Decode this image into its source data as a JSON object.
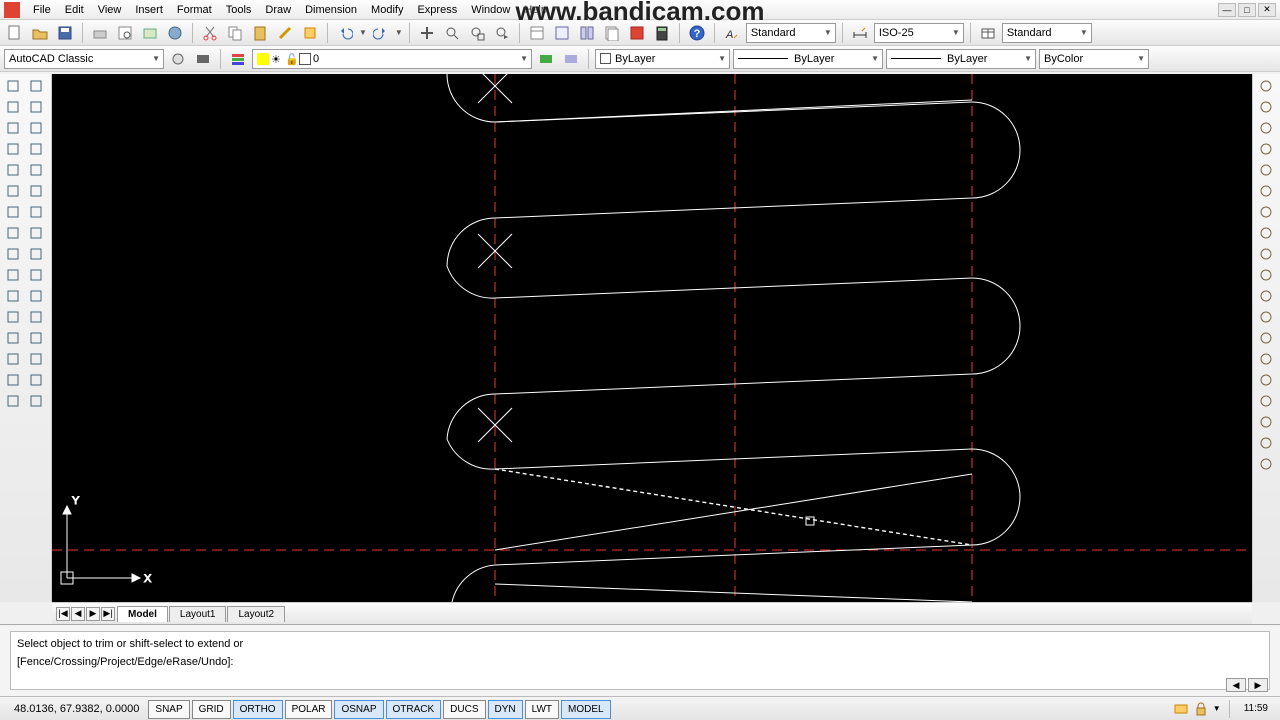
{
  "watermark": "www.bandicam.com",
  "menu": [
    "File",
    "Edit",
    "View",
    "Insert",
    "Format",
    "Tools",
    "Draw",
    "Dimension",
    "Modify",
    "Express",
    "Window",
    "Help"
  ],
  "workspace": "AutoCAD Classic",
  "layer_current": "0",
  "props": {
    "linetype": "ByLayer",
    "lineweight": "ByLayer",
    "plotstyle": "ByLayer",
    "color": "ByColor"
  },
  "style": {
    "text": "Standard",
    "dim": "ISO-25",
    "table": "Standard"
  },
  "tabs": {
    "model": "Model",
    "l1": "Layout1",
    "l2": "Layout2"
  },
  "cmd": {
    "line1": "Select object to trim or shift-select to extend or",
    "line2": "[Fence/Crossing/Project/Edge/eRase/Undo]:"
  },
  "status": {
    "coords": "48.0136, 67.9382, 0.0000",
    "toggles": [
      "SNAP",
      "GRID",
      "ORTHO",
      "POLAR",
      "OSNAP",
      "OTRACK",
      "DUCS",
      "DYN",
      "LWT",
      "MODEL"
    ],
    "on": [
      "ORTHO",
      "OSNAP",
      "OTRACK",
      "DYN",
      "MODEL"
    ],
    "time": "11:59"
  },
  "left_tools": [
    "line-icon",
    "xline-icon",
    "pline-icon",
    "polygon-icon",
    "rect-icon",
    "arc-icon",
    "circle-icon",
    "revcloud-icon",
    "spline-icon",
    "ellipse-icon",
    "ellipsearc-icon",
    "block-icon",
    "point-icon",
    "hatch-icon",
    "gradient-icon",
    "region-icon",
    "table-icon",
    "mtext-icon",
    "ray-icon",
    "mline-icon",
    "donut-icon",
    "wipeout-icon",
    "3dpoly-icon",
    "helix-icon",
    "boundary-icon",
    "addsel-icon",
    "aecdim-icon",
    "mleader-icon",
    "group-icon",
    "measure-icon",
    "divide-icon",
    "A-icon"
  ],
  "right_tools": [
    "erase-icon",
    "copy-icon",
    "mirror-icon",
    "offset-icon",
    "array-icon",
    "move-icon",
    "rotate-icon",
    "scale-icon",
    "stretch-icon",
    "trim-icon",
    "extend-icon",
    "break-icon",
    "join-icon",
    "chamfer-icon",
    "fillet-icon",
    "explode-icon",
    "pan-icon",
    "zoom-icon",
    "orbit-icon"
  ]
}
